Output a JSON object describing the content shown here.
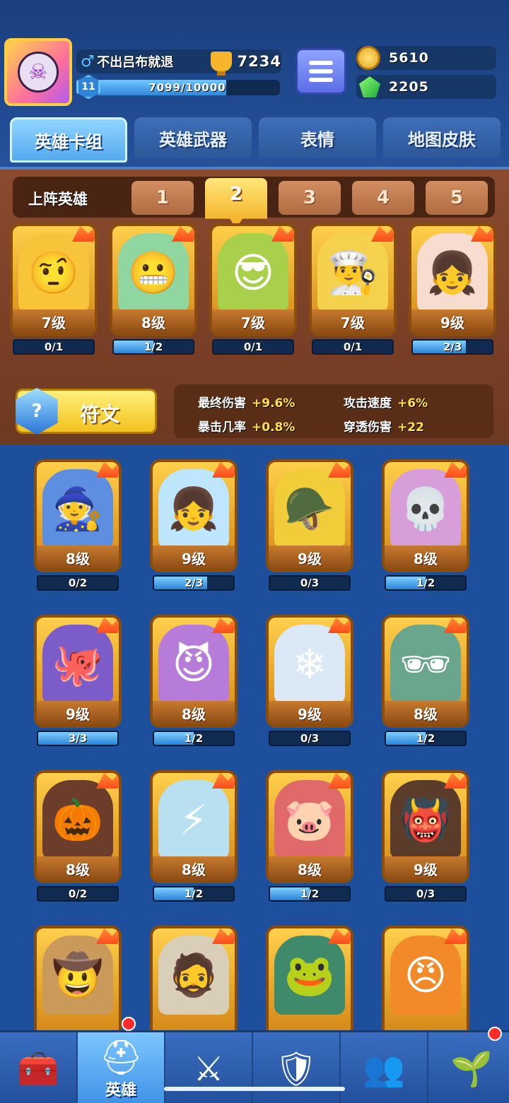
{
  "player": {
    "name": "不出吕布就退",
    "gender_icon": "♂",
    "trophies": "7234",
    "level": "11",
    "xp_text": "7099/10000",
    "xp_fraction": 0.7099
  },
  "currency": {
    "gold": "5610",
    "gems": "2205"
  },
  "tabs": [
    {
      "label": "英雄卡组"
    },
    {
      "label": "英雄武器"
    },
    {
      "label": "表情"
    },
    {
      "label": "地图皮肤"
    }
  ],
  "deck": {
    "label": "上阵英雄",
    "slots": [
      "1",
      "2",
      "3",
      "4",
      "5"
    ],
    "active_slot": 2
  },
  "team": [
    {
      "level": "7级",
      "progress": "0/1",
      "fill": 0,
      "icon": "golden-knight",
      "glyph": "🤨",
      "bg": "#f7c43a"
    },
    {
      "level": "8级",
      "progress": "1/2",
      "fill": 0.5,
      "icon": "zombie-gunner",
      "glyph": "😬",
      "bg": "#8fd6a0"
    },
    {
      "level": "7级",
      "progress": "0/1",
      "fill": 0,
      "icon": "masked-eggplant",
      "glyph": "😎",
      "bg": "#a9d04a"
    },
    {
      "level": "7级",
      "progress": "0/1",
      "fill": 0,
      "icon": "chef-potato",
      "glyph": "👨‍🍳",
      "bg": "#f4d24e"
    },
    {
      "level": "9级",
      "progress": "2/3",
      "fill": 0.667,
      "icon": "girl-hero",
      "glyph": "👧",
      "bg": "#f8dcd0"
    }
  ],
  "rune": {
    "label": "符文",
    "icon_glyph": "?"
  },
  "stats": [
    {
      "name": "最终伤害",
      "value": "+9.6%"
    },
    {
      "name": "攻击速度",
      "value": "+6%"
    },
    {
      "name": "暴击几率",
      "value": "+0.8%"
    },
    {
      "name": "穿透伤害",
      "value": "+22"
    }
  ],
  "heroes": [
    {
      "level": "8级",
      "progress": "0/2",
      "fill": 0,
      "icon": "ice-king",
      "glyph": "🧙",
      "bg": "#5d8ee0"
    },
    {
      "level": "9级",
      "progress": "2/3",
      "fill": 0.667,
      "icon": "blue-hair-girl",
      "glyph": "👧",
      "bg": "#bfe6ff"
    },
    {
      "level": "9级",
      "progress": "0/3",
      "fill": 0,
      "icon": "armored-minion",
      "glyph": "🪖",
      "bg": "#f1cd3a"
    },
    {
      "level": "8级",
      "progress": "1/2",
      "fill": 0.5,
      "icon": "skull-mage",
      "glyph": "💀",
      "bg": "#d79ed9"
    },
    {
      "level": "9级",
      "progress": "3/3",
      "fill": 1,
      "icon": "octopus-pirate",
      "glyph": "🐙",
      "bg": "#7b5cc8"
    },
    {
      "level": "8级",
      "progress": "1/2",
      "fill": 0.5,
      "icon": "medusa",
      "glyph": "😈",
      "bg": "#b77bd9"
    },
    {
      "level": "9级",
      "progress": "0/3",
      "fill": 0,
      "icon": "yeti",
      "glyph": "❄",
      "bg": "#dbe9f7"
    },
    {
      "level": "8级",
      "progress": "1/2",
      "fill": 0.5,
      "icon": "police-zombie",
      "glyph": "🕶",
      "bg": "#6aa58e"
    },
    {
      "level": "8级",
      "progress": "0/2",
      "fill": 0,
      "icon": "lava-golem",
      "glyph": "🎃",
      "bg": "#6b3d2a"
    },
    {
      "level": "8级",
      "progress": "1/2",
      "fill": 0.5,
      "icon": "zeus",
      "glyph": "⚡",
      "bg": "#b9e0f0"
    },
    {
      "level": "8级",
      "progress": "1/2",
      "fill": 0.5,
      "icon": "monocle-pig",
      "glyph": "🐷",
      "bg": "#e06a6a"
    },
    {
      "level": "9级",
      "progress": "0/3",
      "fill": 0,
      "icon": "hooded-shadow",
      "glyph": "👹",
      "bg": "#5b3b2a"
    },
    {
      "level": "",
      "progress": "",
      "fill": 0,
      "icon": "cowboy",
      "glyph": "🤠",
      "bg": "#c99a5a"
    },
    {
      "level": "",
      "progress": "",
      "fill": 0,
      "icon": "bearded-warrior",
      "glyph": "🧔",
      "bg": "#d9cfb8"
    },
    {
      "level": "",
      "progress": "",
      "fill": 0,
      "icon": "green-ninja",
      "glyph": "🐸",
      "bg": "#3f8a6a"
    },
    {
      "level": "",
      "progress": "",
      "fill": 0,
      "icon": "orange-bomb",
      "glyph": "😠",
      "bg": "#f28a2a"
    }
  ],
  "nav": [
    {
      "label": "",
      "icon": "treasure-chest-icon",
      "glyph": "🧰"
    },
    {
      "label": "英雄",
      "icon": "knight-helmet-icon",
      "glyph": "⛑"
    },
    {
      "label": "",
      "icon": "crossed-swords-icon",
      "glyph": "⚔"
    },
    {
      "label": "",
      "icon": "crown-shield-icon",
      "glyph": "🛡"
    },
    {
      "label": "",
      "icon": "team-banner-icon",
      "glyph": "👥"
    },
    {
      "label": "",
      "icon": "sprout-island-icon",
      "glyph": "🌱"
    }
  ],
  "colors": {
    "accent": "#f3c21c",
    "panel": "#6e3921",
    "background": "#1d4f9c"
  }
}
